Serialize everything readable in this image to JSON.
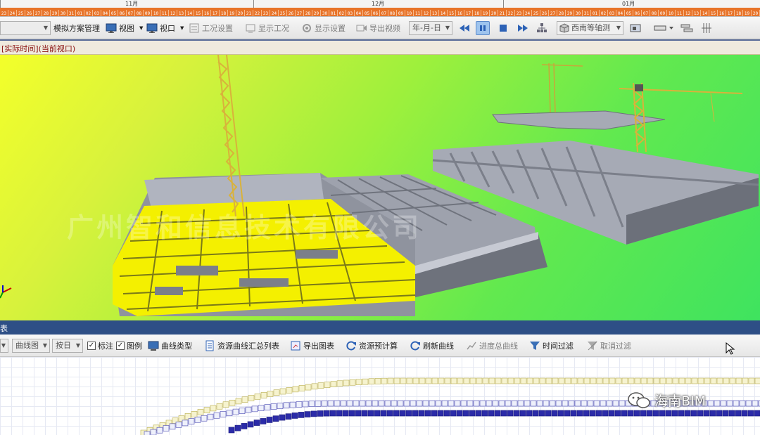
{
  "timeline": {
    "months": [
      "11月",
      "12月",
      "01月"
    ],
    "days": [
      "23",
      "24",
      "25",
      "26",
      "27",
      "28",
      "29",
      "30",
      "31",
      "01",
      "02",
      "03",
      "04",
      "05",
      "06",
      "07",
      "08",
      "09",
      "10",
      "11",
      "12",
      "13",
      "14",
      "15",
      "16",
      "17",
      "18",
      "19",
      "20",
      "21",
      "22",
      "23",
      "24",
      "25",
      "26",
      "27",
      "28",
      "29",
      "30",
      "01",
      "02",
      "03",
      "04",
      "05",
      "06",
      "07",
      "08",
      "09",
      "10",
      "11",
      "12",
      "13",
      "14",
      "15",
      "16",
      "17",
      "18",
      "19",
      "20",
      "21",
      "22",
      "23",
      "24",
      "25",
      "26",
      "27",
      "28",
      "29",
      "30",
      "31",
      "01",
      "02",
      "03",
      "04",
      "05",
      "06",
      "07",
      "08",
      "09",
      "10",
      "11",
      "12",
      "13",
      "14",
      "15",
      "16",
      "17",
      "18",
      "19",
      "20",
      "21",
      "22",
      "23",
      "24",
      "25",
      "26"
    ]
  },
  "toolbar1": {
    "scheme_label": "模拟方案管理",
    "view_label": "视图",
    "viewport_label": "视口",
    "work_settings": "工况设置",
    "show_work": "显示工况",
    "display_settings": "显示设置",
    "export_video": "导出视频",
    "date_format": "年-月-日",
    "camera_view": "西南等轴测"
  },
  "view_header": {
    "text": "[实际时间](当前视口)"
  },
  "viewport": {
    "watermark": "广州智和信息技术有限公司"
  },
  "panel_title": {
    "text": "表"
  },
  "toolbar2": {
    "combo1": "曲线图",
    "combo2": "按日",
    "annotate_label": "标注",
    "legend_label": "图例",
    "curve_type": "曲线类型",
    "resource_summary": "资源曲线汇总列表",
    "export_chart": "导出图表",
    "resource_forecast": "资源预计算",
    "refresh_curve": "刷新曲线",
    "progress_curve": "进度总曲线",
    "time_filter": "时间过滤",
    "cancel_filter": "取消过滤"
  },
  "brand": {
    "text": "海南BIM"
  },
  "colors": {
    "timeline_days": "#e8742a",
    "panel_title": "#2e4f86",
    "model_yellow": "#f4f000",
    "model_gray": "#a6aab5",
    "curve_blue": "#2b2ba8",
    "curve_yellow": "#e7df6b"
  }
}
